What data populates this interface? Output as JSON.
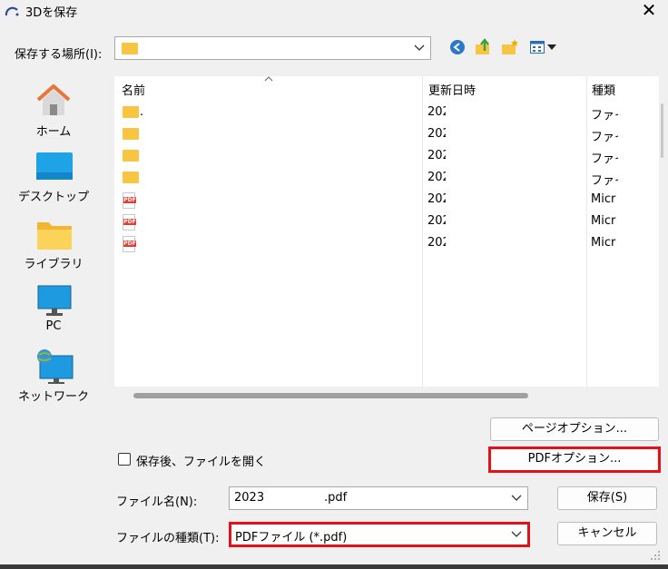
{
  "window": {
    "title": "3Dを保存",
    "close_symbol": "✕"
  },
  "location": {
    "label": "保存する場所(I):",
    "value": ""
  },
  "places": [
    {
      "label": "ホーム",
      "icon": "home-icon"
    },
    {
      "label": "デスクトップ",
      "icon": "desktop-icon"
    },
    {
      "label": "ライブラリ",
      "icon": "library-folder-icon"
    },
    {
      "label": "PC",
      "icon": "pc-monitor-icon"
    },
    {
      "label": "ネットワーク",
      "icon": "network-icon"
    }
  ],
  "columns": {
    "name": "名前",
    "date": "更新日時",
    "type": "種類"
  },
  "files": [
    {
      "icon": "folder-icon",
      "name": ".",
      "date": "202",
      "type": "ファイ"
    },
    {
      "icon": "folder-icon",
      "name": "",
      "date": "202",
      "type": "ファイ"
    },
    {
      "icon": "folder-icon",
      "name": "",
      "date": "202",
      "type": "ファイ"
    },
    {
      "icon": "folder-icon",
      "name": "",
      "date": "202",
      "type": "ファイ"
    },
    {
      "icon": "pdf-file-icon",
      "name": "",
      "date": "202",
      "type": "Micr"
    },
    {
      "icon": "pdf-file-icon",
      "name": "",
      "date": "202",
      "type": "Micr"
    },
    {
      "icon": "pdf-file-icon",
      "name": "",
      "date": "202",
      "type": "Micr"
    }
  ],
  "buttons": {
    "page_options": "ページオプション...",
    "pdf_options": "PDFオプション...",
    "save": "保存(S)",
    "cancel": "キャンセル"
  },
  "open_after_save": {
    "label": "保存後、ファイルを開く",
    "checked": false
  },
  "filename": {
    "label": "ファイル名(N):",
    "prefix": "2023",
    "suffix": ".pdf"
  },
  "filetype": {
    "label": "ファイルの種類(T):",
    "value": "PDFファイル (*.pdf)"
  },
  "colors": {
    "highlight": "#e0121b",
    "folder": "#f8c542",
    "pdf": "#e03c31"
  }
}
